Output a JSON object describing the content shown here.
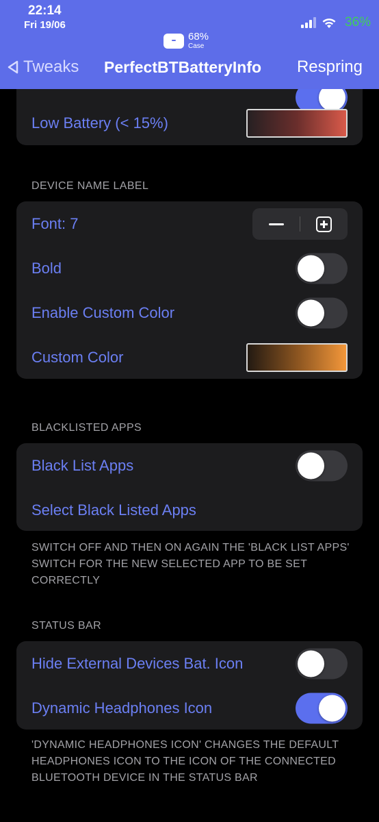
{
  "status_bar": {
    "time": "22:14",
    "date": "Fri 19/06",
    "battery_percent": "36%",
    "case_widget": {
      "percent": "68%",
      "label": "Case"
    }
  },
  "nav": {
    "back_label": "Tweaks",
    "title": "PerfectBTBatteryInfo",
    "respring_label": "Respring"
  },
  "top_card": {
    "low_battery_label": "Low Battery (< 15%)",
    "hidden_toggle_on": true
  },
  "device_name_section": {
    "header": "DEVICE NAME LABEL",
    "font_label": "Font: 7",
    "bold_label": "Bold",
    "bold_on": false,
    "enable_custom_color_label": "Enable Custom Color",
    "enable_custom_color_on": false,
    "custom_color_label": "Custom Color"
  },
  "blacklisted_section": {
    "header": "BLACKLISTED APPS",
    "black_list_label": "Black List Apps",
    "black_list_on": false,
    "select_label": "Select Black Listed Apps",
    "footer": "SWITCH OFF AND THEN ON AGAIN THE 'BLACK LIST APPS' SWITCH FOR THE NEW SELECTED APP TO BE SET CORRECTLY"
  },
  "status_bar_section": {
    "header": "STATUS BAR",
    "hide_external_label": "Hide External Devices Bat. Icon",
    "hide_external_on": false,
    "dynamic_headphones_label": "Dynamic Headphones Icon",
    "dynamic_headphones_on": true,
    "footer": "'DYNAMIC HEADPHONES ICON' CHANGES THE DEFAULT HEADPHONES ICON TO THE ICON OF THE CONNECTED BLUETOOTH DEVICE IN THE STATUS BAR"
  },
  "colors": {
    "accent": "#5d6de9",
    "label_blue": "#6b7ff3",
    "battery_green": "#3fcf5a",
    "card_background": "#1c1c1e"
  },
  "icons": [
    "cellular-signal-icon",
    "wifi-icon",
    "case-icon",
    "back-chevron-icon",
    "minus-icon",
    "plus-icon"
  ]
}
